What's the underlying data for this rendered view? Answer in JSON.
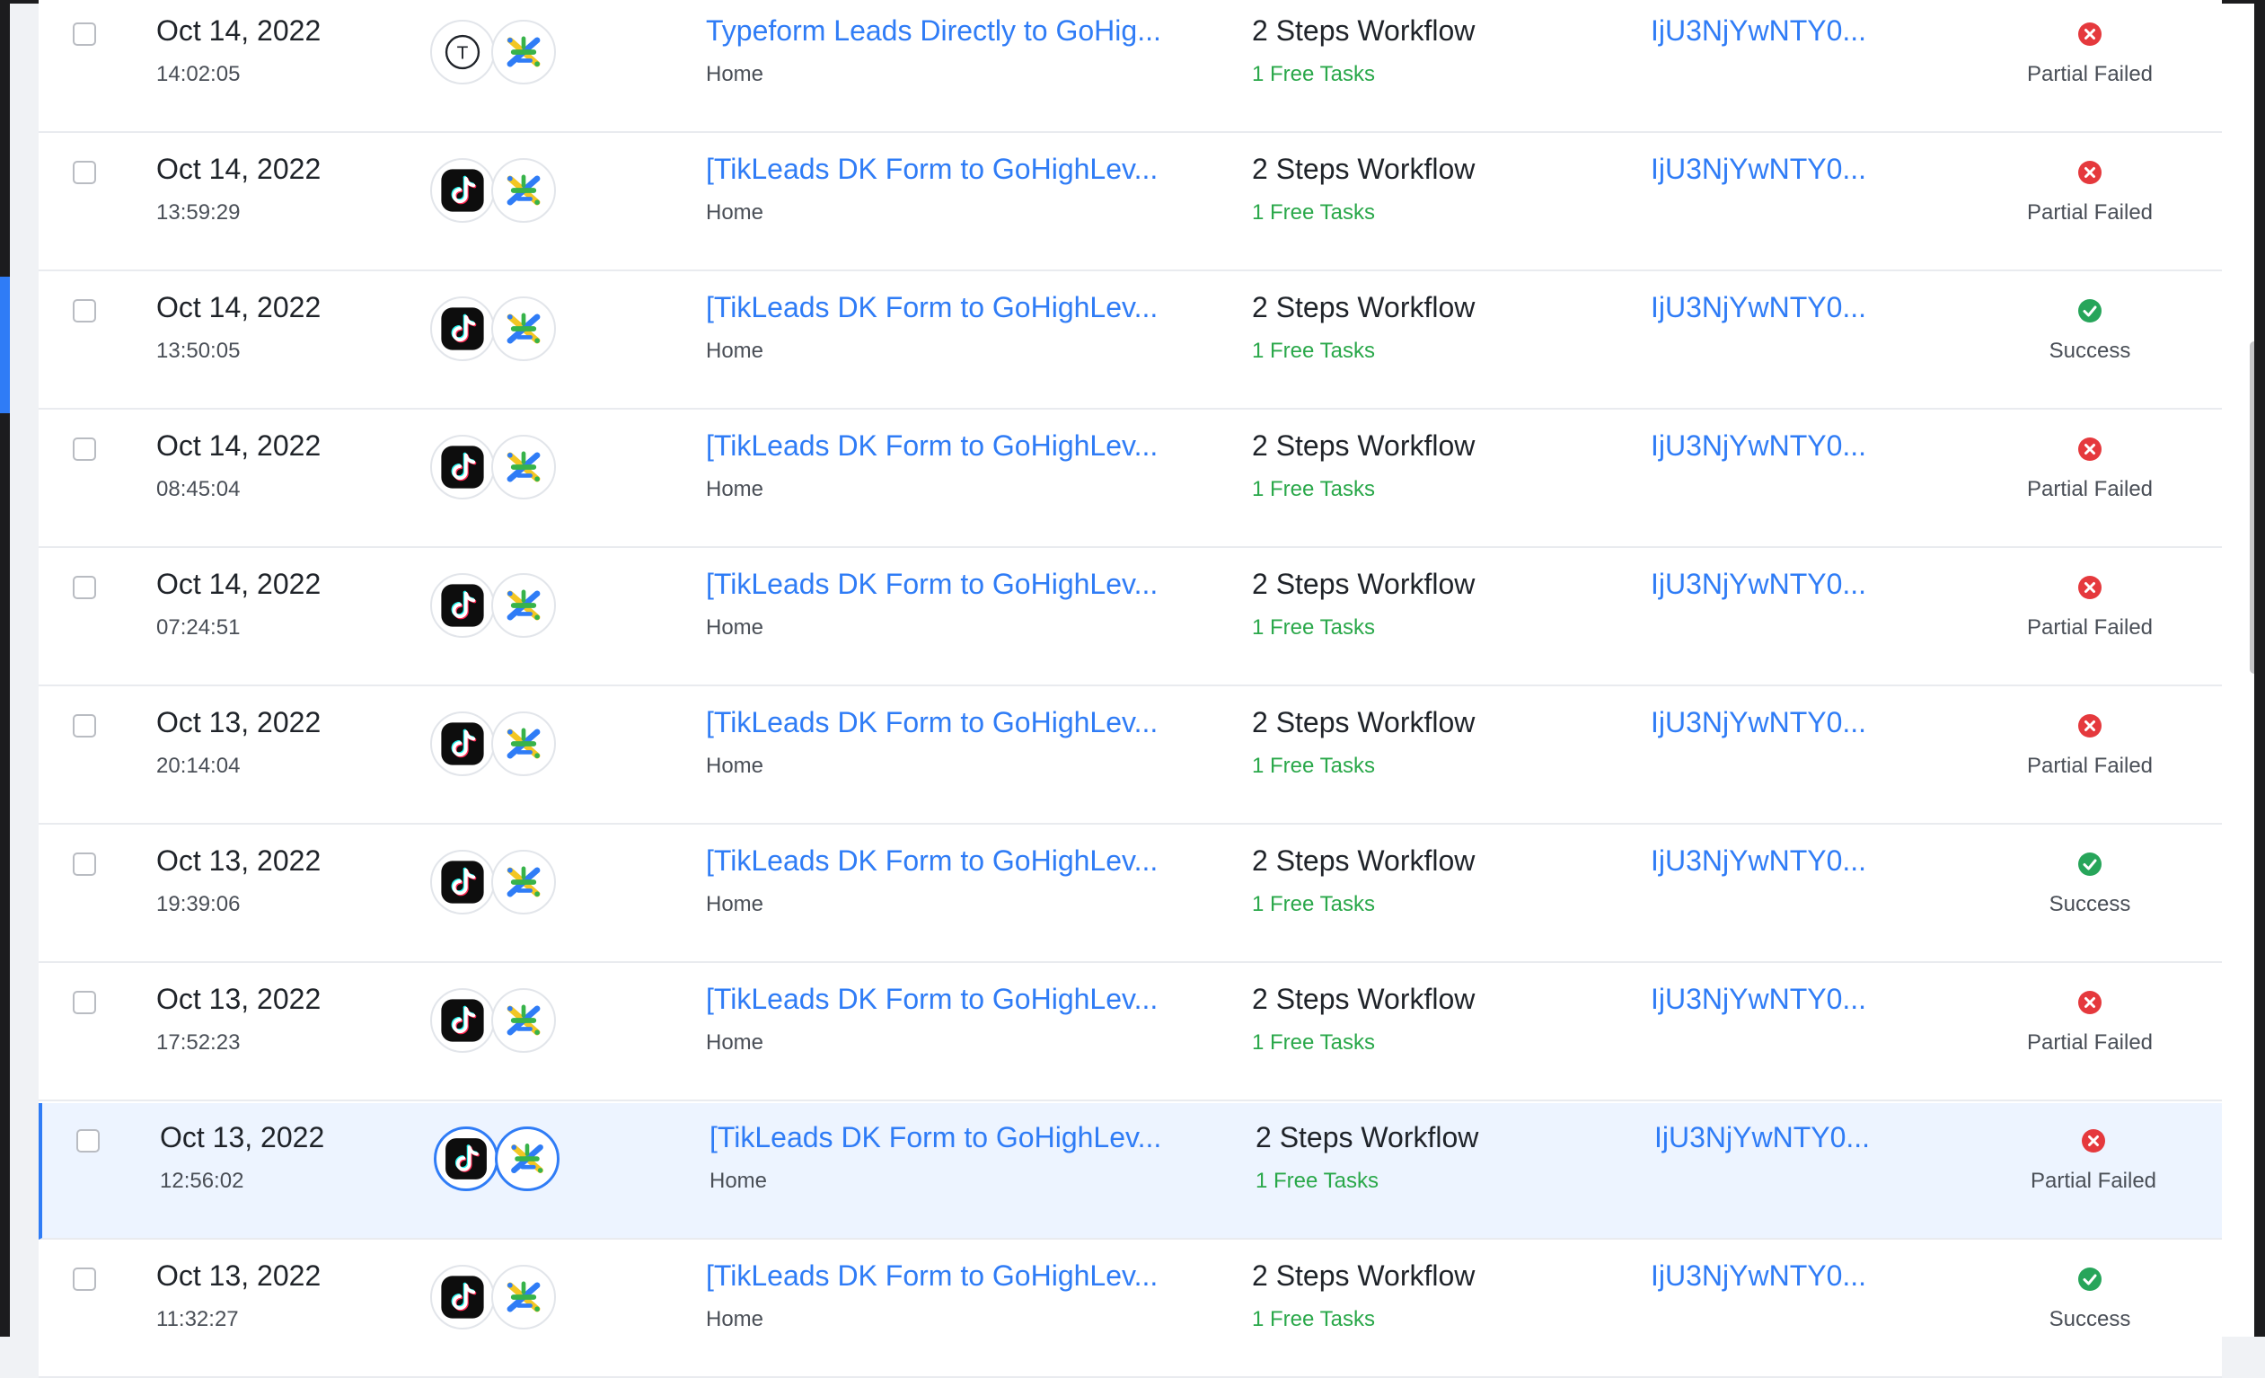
{
  "colors": {
    "link": "#2f7cf6",
    "tasks_green": "#2aa84a",
    "failed_red": "#e5393d",
    "success_green": "#27a55a",
    "selected_row_bg": "#edf4ff"
  },
  "rows": [
    {
      "date": "Oct 14, 2022",
      "time": "14:02:05",
      "trigger_app": "typeform-icon",
      "trigger_letter": "T",
      "action_app": "gohighlevel-icon",
      "workflow_name": "Typeform Leads Directly to GoHig...",
      "folder": "Home",
      "steps": "2 Steps Workflow",
      "tasks": "1 Free Tasks",
      "request_id": "IjU3NjYwNTY0...",
      "status": "Partial Failed",
      "status_type": "failed"
    },
    {
      "date": "Oct 14, 2022",
      "time": "13:59:29",
      "trigger_app": "tiktok-icon",
      "action_app": "gohighlevel-icon",
      "workflow_name": "[TikLeads DK Form to GoHighLev...",
      "folder": "Home",
      "steps": "2 Steps Workflow",
      "tasks": "1 Free Tasks",
      "request_id": "IjU3NjYwNTY0...",
      "status": "Partial Failed",
      "status_type": "failed"
    },
    {
      "date": "Oct 14, 2022",
      "time": "13:50:05",
      "trigger_app": "tiktok-icon",
      "action_app": "gohighlevel-icon",
      "workflow_name": "[TikLeads DK Form to GoHighLev...",
      "folder": "Home",
      "steps": "2 Steps Workflow",
      "tasks": "1 Free Tasks",
      "request_id": "IjU3NjYwNTY0...",
      "status": "Success",
      "status_type": "success"
    },
    {
      "date": "Oct 14, 2022",
      "time": "08:45:04",
      "trigger_app": "tiktok-icon",
      "action_app": "gohighlevel-icon",
      "workflow_name": "[TikLeads DK Form to GoHighLev...",
      "folder": "Home",
      "steps": "2 Steps Workflow",
      "tasks": "1 Free Tasks",
      "request_id": "IjU3NjYwNTY0...",
      "status": "Partial Failed",
      "status_type": "failed"
    },
    {
      "date": "Oct 14, 2022",
      "time": "07:24:51",
      "trigger_app": "tiktok-icon",
      "action_app": "gohighlevel-icon",
      "workflow_name": "[TikLeads DK Form to GoHighLev...",
      "folder": "Home",
      "steps": "2 Steps Workflow",
      "tasks": "1 Free Tasks",
      "request_id": "IjU3NjYwNTY0...",
      "status": "Partial Failed",
      "status_type": "failed"
    },
    {
      "date": "Oct 13, 2022",
      "time": "20:14:04",
      "trigger_app": "tiktok-icon",
      "action_app": "gohighlevel-icon",
      "workflow_name": "[TikLeads DK Form to GoHighLev...",
      "folder": "Home",
      "steps": "2 Steps Workflow",
      "tasks": "1 Free Tasks",
      "request_id": "IjU3NjYwNTY0...",
      "status": "Partial Failed",
      "status_type": "failed"
    },
    {
      "date": "Oct 13, 2022",
      "time": "19:39:06",
      "trigger_app": "tiktok-icon",
      "action_app": "gohighlevel-icon",
      "workflow_name": "[TikLeads DK Form to GoHighLev...",
      "folder": "Home",
      "steps": "2 Steps Workflow",
      "tasks": "1 Free Tasks",
      "request_id": "IjU3NjYwNTY0...",
      "status": "Success",
      "status_type": "success"
    },
    {
      "date": "Oct 13, 2022",
      "time": "17:52:23",
      "trigger_app": "tiktok-icon",
      "action_app": "gohighlevel-icon",
      "workflow_name": "[TikLeads DK Form to GoHighLev...",
      "folder": "Home",
      "steps": "2 Steps Workflow",
      "tasks": "1 Free Tasks",
      "request_id": "IjU3NjYwNTY0...",
      "status": "Partial Failed",
      "status_type": "failed"
    },
    {
      "date": "Oct 13, 2022",
      "time": "12:56:02",
      "trigger_app": "tiktok-icon",
      "action_app": "gohighlevel-icon",
      "workflow_name": "[TikLeads DK Form to GoHighLev...",
      "folder": "Home",
      "steps": "2 Steps Workflow",
      "tasks": "1 Free Tasks",
      "request_id": "IjU3NjYwNTY0...",
      "status": "Partial Failed",
      "status_type": "failed",
      "selected": true
    },
    {
      "date": "Oct 13, 2022",
      "time": "11:32:27",
      "trigger_app": "tiktok-icon",
      "action_app": "gohighlevel-icon",
      "workflow_name": "[TikLeads DK Form to GoHighLev...",
      "folder": "Home",
      "steps": "2 Steps Workflow",
      "tasks": "1 Free Tasks",
      "request_id": "IjU3NjYwNTY0...",
      "status": "Success",
      "status_type": "success"
    }
  ]
}
